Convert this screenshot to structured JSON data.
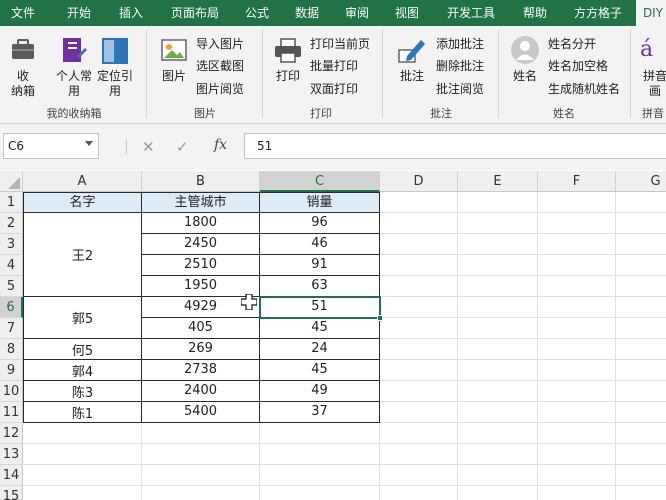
{
  "ribbon_tabs": [
    "文件",
    "开始",
    "插入",
    "页面布局",
    "公式",
    "数据",
    "审阅",
    "视图",
    "开发工具",
    "帮助",
    "方方格子",
    "DIY"
  ],
  "ribbon": {
    "groups": {
      "favorites": {
        "label": "我的收纳箱",
        "toolbox": "收\n纳箱",
        "personal": "个人常\n用",
        "locate": "定位引\n用"
      },
      "image": {
        "label": "图片",
        "picture": "图片",
        "import_pictures": "导入图片",
        "region_screenshot": "选区截图",
        "picture_view": "图片阅览"
      },
      "print": {
        "label": "打印",
        "print": "打印",
        "print_current_page": "打印当前页",
        "batch_print": "批量打印",
        "duplex_print": "双面打印"
      },
      "comment": {
        "label": "批注",
        "comment": "批注",
        "add_comment": "添加批注",
        "delete_comment": "删除批注",
        "comment_view": "批注阅览"
      },
      "name": {
        "label": "姓名",
        "name": "姓名",
        "split_name": "姓名分开",
        "name_add_space": "姓名加空格",
        "random_name": "生成随机姓名"
      },
      "pinyin": {
        "label": "拼音",
        "pinyin": "拼音\n画"
      }
    }
  },
  "formula_bar": {
    "name_box": "C6",
    "fx": "fx",
    "value": "51"
  },
  "sheet": {
    "columns": [
      "A",
      "B",
      "C",
      "D",
      "E",
      "F",
      "G"
    ],
    "rows": [
      "1",
      "2",
      "3",
      "4",
      "5",
      "6",
      "7",
      "8",
      "9",
      "10",
      "11",
      "12",
      "13",
      "14",
      "15"
    ],
    "headers": [
      "名字",
      "主管城市",
      "销量"
    ],
    "names": [
      {
        "label": "王2"
      },
      {
        "label": "郭5"
      },
      {
        "label": "何5"
      },
      {
        "label": "郭4"
      },
      {
        "label": "陈3"
      },
      {
        "label": "陈1"
      }
    ],
    "data": [
      {
        "b": "1800",
        "c": "96"
      },
      {
        "b": "2450",
        "c": "46"
      },
      {
        "b": "2510",
        "c": "91"
      },
      {
        "b": "1950",
        "c": "63"
      },
      {
        "b": "4929",
        "c": "51"
      },
      {
        "b": "405",
        "c": "45"
      },
      {
        "b": "269",
        "c": "24"
      },
      {
        "b": "2738",
        "c": "45"
      },
      {
        "b": "2400",
        "c": "49"
      },
      {
        "b": "5400",
        "c": "37"
      }
    ],
    "selected_cell": "C6"
  },
  "colors": {
    "excel_green": "#217346",
    "header_fill": "#ddebf7"
  }
}
